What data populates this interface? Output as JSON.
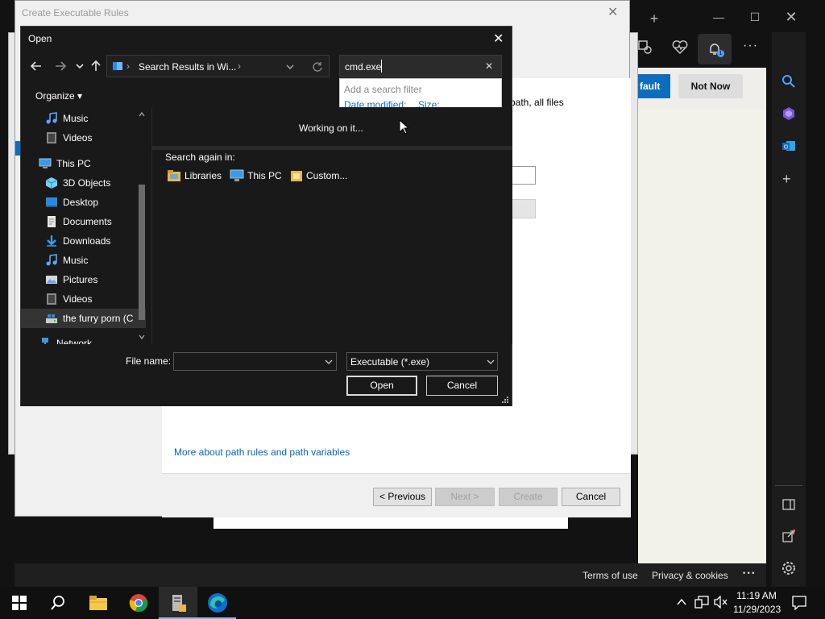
{
  "wizard": {
    "title": "Create Executable Rules",
    "close": "✕",
    "desc_fragment": "path, all files",
    "link": "More about path rules and path variables",
    "buttons": {
      "previous": "< Previous",
      "next": "Next >",
      "create": "Create",
      "cancel": "Cancel"
    }
  },
  "edge": {
    "default_btn": "fault",
    "not_now_btn": "Not Now",
    "footer": {
      "terms": "Terms of use",
      "privacy": "Privacy & cookies",
      "more": "• • •"
    },
    "notification_badge": "1"
  },
  "dialog": {
    "title": "Open",
    "close": "✕",
    "address": "Search Results in Wi...",
    "search_value": "cmd.exe",
    "search_clear": "✕",
    "filter_header": "Add a search filter",
    "filter_date": "Date modified:",
    "filter_size": "Size:",
    "organize": "Organize ▾",
    "nav_items": [
      {
        "label": "Music",
        "icon": "music-icon"
      },
      {
        "label": "Videos",
        "icon": "videos-icon"
      },
      {
        "label": "This PC",
        "icon": "computer-icon"
      },
      {
        "label": "3D Objects",
        "icon": "3d-objects-icon"
      },
      {
        "label": "Desktop",
        "icon": "desktop-icon"
      },
      {
        "label": "Documents",
        "icon": "documents-icon"
      },
      {
        "label": "Downloads",
        "icon": "downloads-icon"
      },
      {
        "label": "Music",
        "icon": "music-icon"
      },
      {
        "label": "Pictures",
        "icon": "pictures-icon"
      },
      {
        "label": "Videos",
        "icon": "videos-icon"
      },
      {
        "label": "the furry porn (C",
        "icon": "drive-icon"
      },
      {
        "label": "Network",
        "icon": "network-icon"
      }
    ],
    "working": "Working on it...",
    "search_again": "Search again in:",
    "locations": {
      "libraries": "Libraries",
      "this_pc": "This PC",
      "custom": "Custom..."
    },
    "file_name_label": "File name:",
    "file_name_value": "",
    "file_type": "Executable (*.exe)",
    "open_btn": "Open",
    "cancel_btn": "Cancel"
  },
  "taskbar": {
    "time": "11:19 AM",
    "date": "11/29/2023",
    "apps": [
      "start-icon",
      "search-icon",
      "file-explorer-icon",
      "chrome-icon",
      "server-manager-icon",
      "edge-icon"
    ]
  },
  "colors": {
    "accent": "#0f6cbd",
    "link": "#0066cc",
    "filter_link": "#1a6ec2",
    "dialog_bg": "#191919"
  }
}
